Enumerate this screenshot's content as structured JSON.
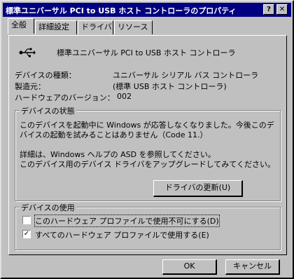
{
  "window": {
    "title": "標準ユニバーサル PCI to USB ホスト コントローラのプロパティ",
    "help_btn": "?",
    "close_btn": "✕"
  },
  "tabs": [
    {
      "label": "全般"
    },
    {
      "label": "詳細設定"
    },
    {
      "label": "ドライバ"
    },
    {
      "label": "リソース"
    }
  ],
  "device": {
    "icon": "usb-icon",
    "name": "標準ユニバーサル PCI to USB ホスト コントローラ",
    "type_label": "デバイスの種類：",
    "type_value": "ユニバーサル シリアル バス コントローラ",
    "manufacturer_label": "製造元：",
    "manufacturer_value": "(標準 USB ホスト コントローラ)",
    "hardware_version_label": "ハードウェアのバージョン：",
    "hardware_version_value": "002"
  },
  "status": {
    "legend": "デバイスの状態",
    "line1": "このデバイスを起動中に Windows が応答しなくなりました。今後このデ",
    "line2": "バイスの起動を試みることはありません（Code 11.）",
    "line3": "詳細は、Windows ヘルプの ASD を参照してください。",
    "line4": "このデバイス用のデバイス ドライバをアップグレードしてみてください。",
    "update_button": "ドライバの更新(U)"
  },
  "usage": {
    "legend": "デバイスの使用",
    "option1": "このハードウェア プロファイルで使用不可にする(D)",
    "option1_checked": false,
    "option2": "すべてのハードウェア プロファイルで使用する(E)",
    "option2_checked": true
  },
  "buttons": {
    "ok": "OK",
    "cancel": "キャンセル"
  }
}
